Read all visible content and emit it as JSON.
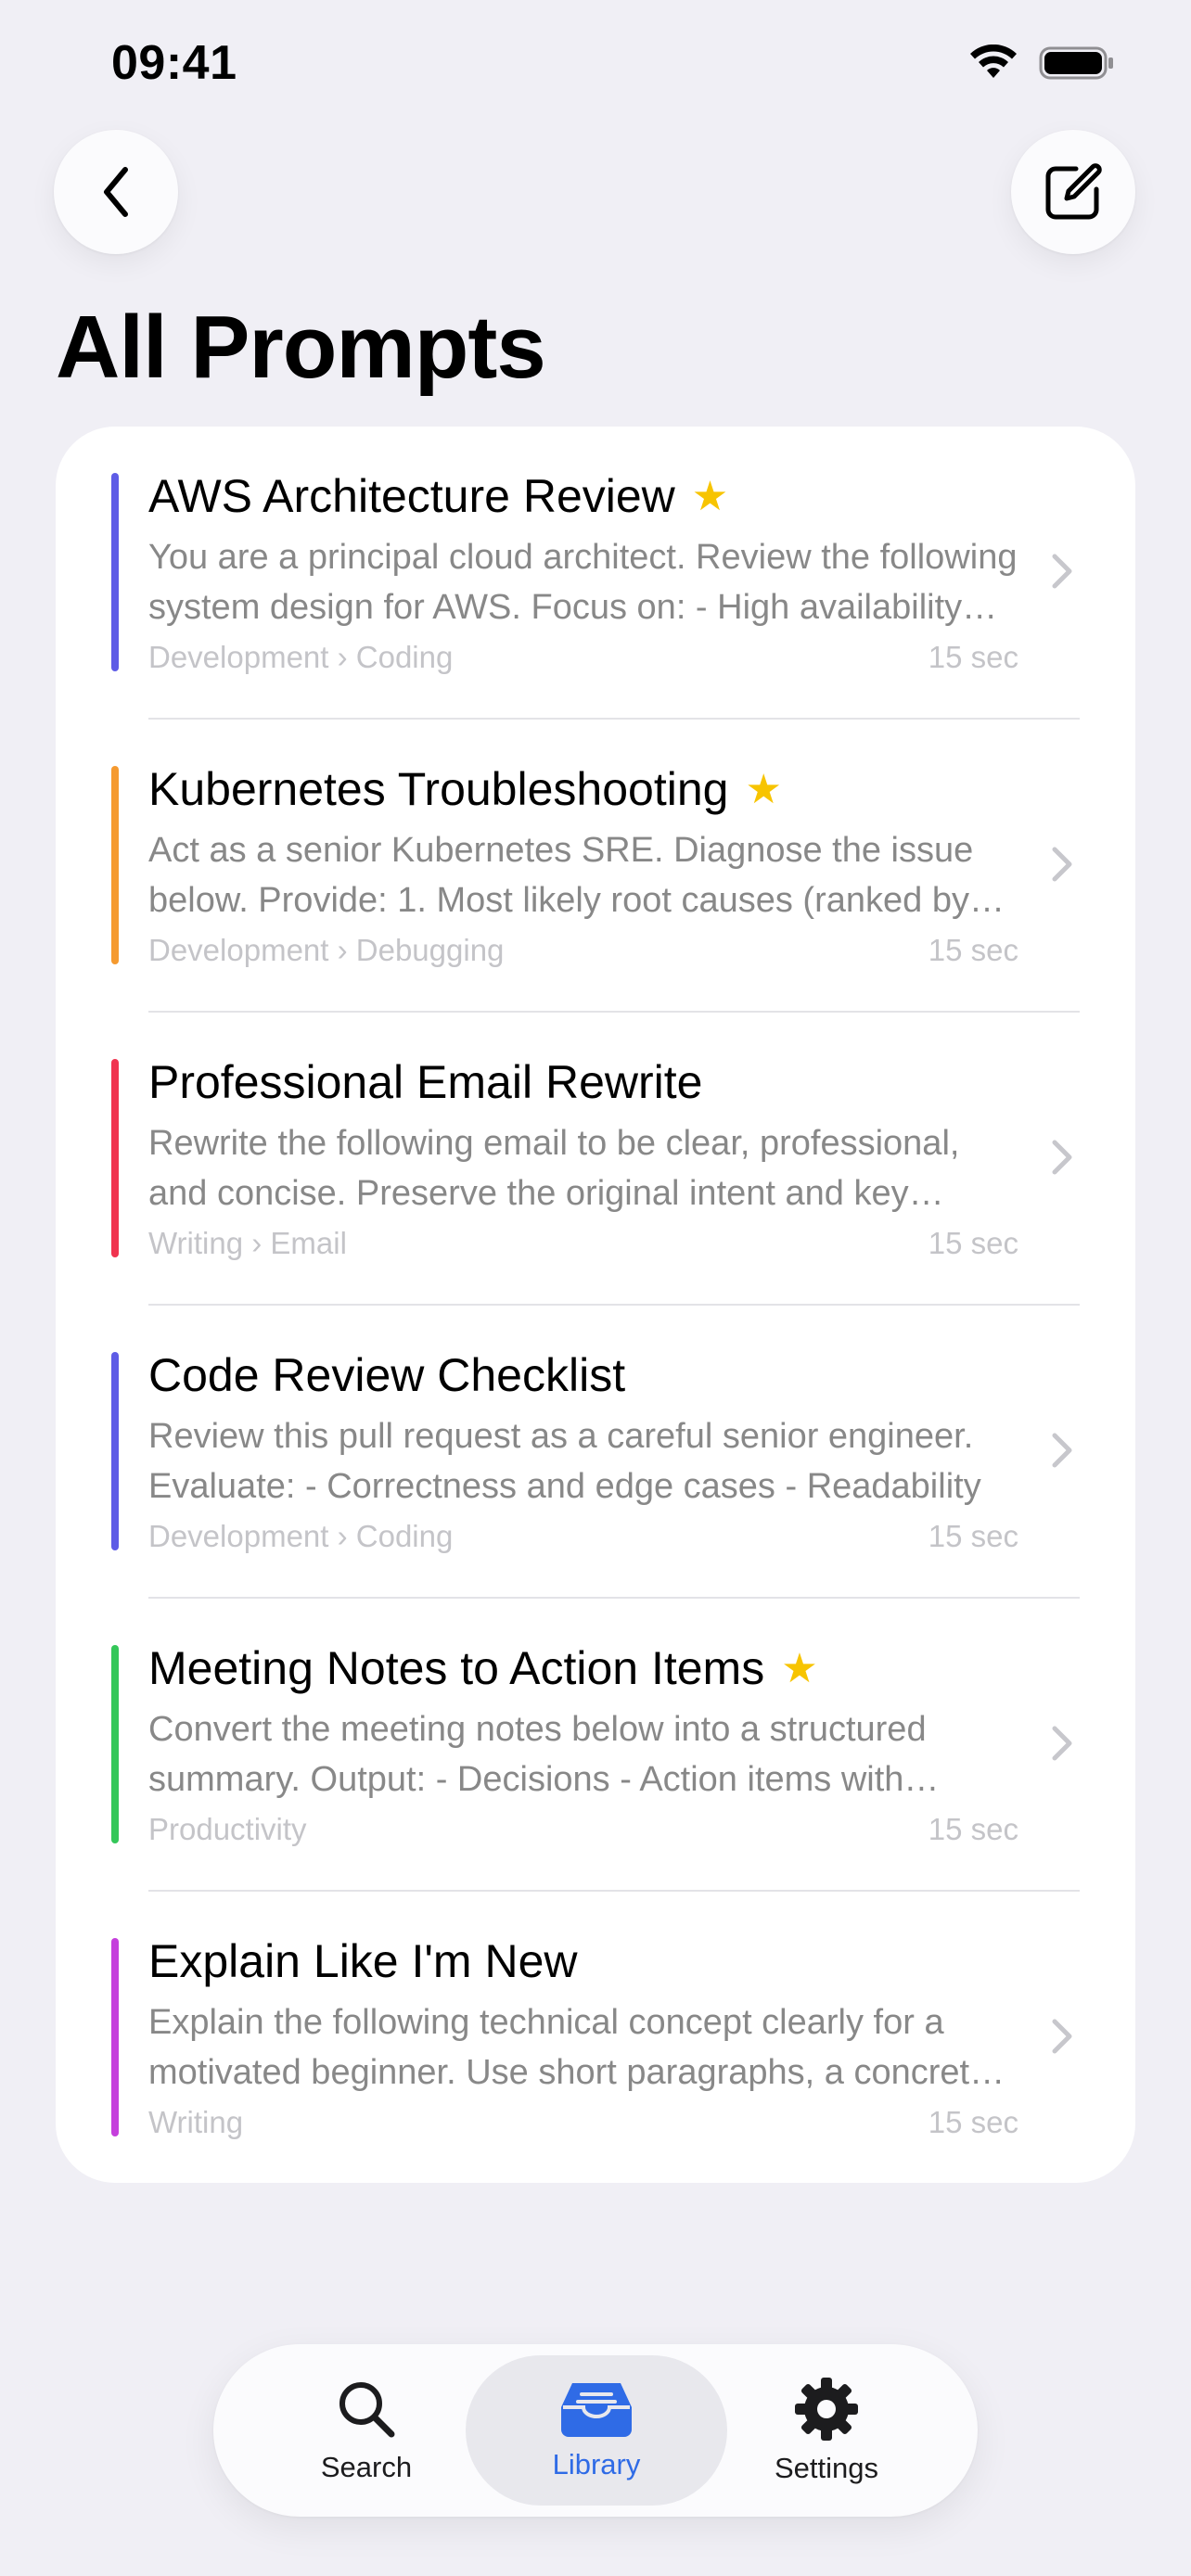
{
  "status_bar": {
    "time": "09:41"
  },
  "header": {
    "title": "All Prompts"
  },
  "prompts": [
    {
      "title": "AWS Architecture Review",
      "starred": true,
      "accent": "#5e5ce6",
      "description": "You are a principal cloud architect. Review the following system design for AWS.  Focus on: - High availability and fault tolerance",
      "category": "Development › Coding",
      "time": "15 sec"
    },
    {
      "title": "Kubernetes Troubleshooting",
      "starred": true,
      "accent": "#f59a2f",
      "description": "Act as a senior Kubernetes SRE. Diagnose the issue below.  Provide: 1. Most likely root causes (ranked by probability)",
      "category": "Development › Debugging",
      "time": "15 sec"
    },
    {
      "title": "Professional Email Rewrite",
      "starred": false,
      "accent": "#f0334f",
      "description": "Rewrite the following email to be clear, professional, and concise. Preserve the original intent and key details.",
      "category": "Writing › Email",
      "time": "15 sec"
    },
    {
      "title": "Code Review Checklist",
      "starred": false,
      "accent": "#5e5ce6",
      "description": "Review this pull request as a careful senior engineer.  Evaluate: - Correctness and edge cases - Readability",
      "category": "Development › Coding",
      "time": "15 sec"
    },
    {
      "title": "Meeting Notes to Action Items",
      "starred": true,
      "accent": "#34c759",
      "description": "Convert the meeting notes below into a structured summary.  Output: - Decisions - Action items with owners",
      "category": "Productivity",
      "time": "15 sec"
    },
    {
      "title": "Explain Like I'm New",
      "starred": false,
      "accent": "#c53fdc",
      "description": "Explain the following technical concept clearly for a motivated beginner. Use short paragraphs, a concrete example",
      "category": "Writing",
      "time": "15 sec"
    }
  ],
  "tab_bar": {
    "tabs": [
      {
        "label": "Search",
        "icon": "search-icon",
        "active": false
      },
      {
        "label": "Library",
        "icon": "tray-icon",
        "active": true
      },
      {
        "label": "Settings",
        "icon": "gear-icon",
        "active": false
      }
    ]
  },
  "colors": {
    "accent_blue": "#2f6be6",
    "star": "#f7c400",
    "background": "#f0eff5"
  }
}
